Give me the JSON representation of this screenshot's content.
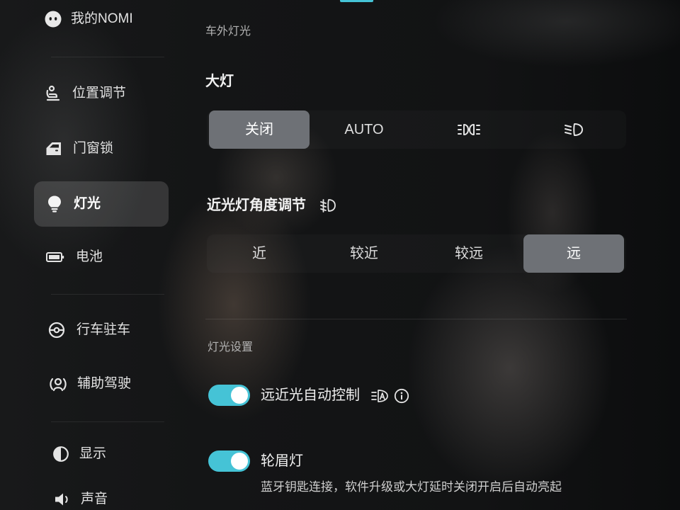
{
  "colors": {
    "accent": "#45c3d6",
    "selected_segment": "#6e7176",
    "selected_nav": "rgba(255,255,255,0.14)",
    "text_secondary": "#b3b3b3"
  },
  "sidebar": {
    "selected_index": 3,
    "items": [
      {
        "label": "我的NOMI",
        "icon": "nomi-icon"
      },
      {
        "label": "位置调节",
        "icon": "seat-adjust-icon"
      },
      {
        "label": "门窗锁",
        "icon": "door-lock-icon"
      },
      {
        "label": "灯光",
        "icon": "light-bulb-icon"
      },
      {
        "label": "电池",
        "icon": "battery-icon"
      },
      {
        "label": "行车驻车",
        "icon": "steering-wheel-icon"
      },
      {
        "label": "辅助驾驶",
        "icon": "driver-assist-icon"
      },
      {
        "label": "显示",
        "icon": "display-icon"
      },
      {
        "label": "声音",
        "icon": "speaker-icon"
      }
    ]
  },
  "main": {
    "section_exterior": "车外灯光",
    "headlight": {
      "title": "大灯",
      "selected_index": 0,
      "options": [
        {
          "label": "关闭"
        },
        {
          "label": "AUTO"
        },
        {
          "icon": "parking-light-icon"
        },
        {
          "icon": "low-beam-icon"
        }
      ]
    },
    "beam_angle": {
      "title": "近光灯角度调节",
      "icon": "headlight-level-icon",
      "selected_index": 3,
      "options": [
        {
          "label": "近"
        },
        {
          "label": "较近"
        },
        {
          "label": "较远"
        },
        {
          "label": "远"
        }
      ]
    },
    "section_settings": "灯光设置",
    "auto_beam": {
      "label": "远近光自动控制",
      "on": true,
      "icon": "auto-high-beam-icon",
      "info_icon": "info-icon"
    },
    "wheel_arch_light": {
      "label": "轮眉灯",
      "on": true,
      "description": "蓝牙钥匙连接，软件升级或大灯延时关闭开启后自动亮起"
    }
  }
}
